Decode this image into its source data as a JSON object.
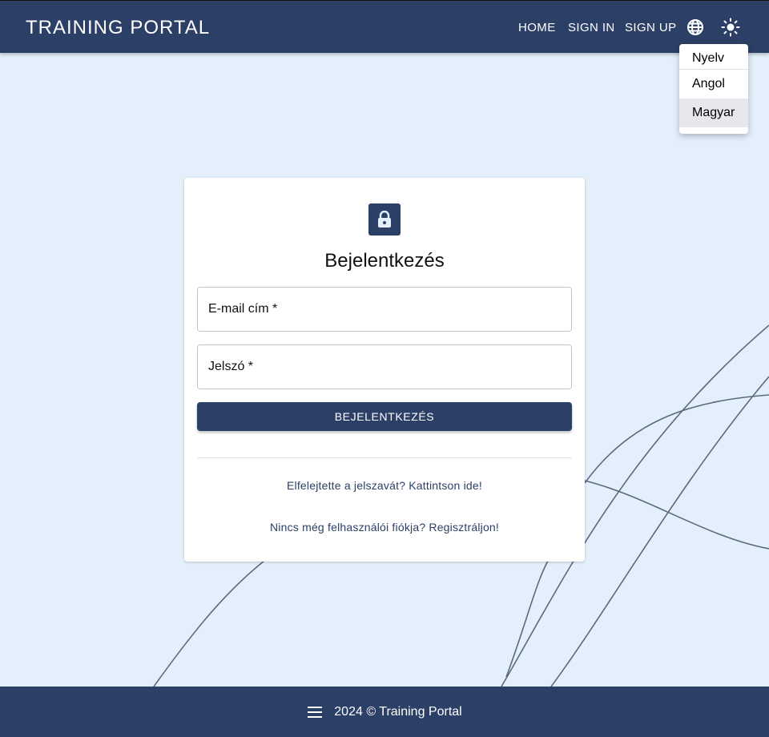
{
  "appbar": {
    "brand": "TRAINING PORTAL",
    "nav": {
      "home": "HOME",
      "sign_in": "SIGN IN",
      "sign_up": "SIGN UP"
    },
    "icons": {
      "language": "globe-icon",
      "theme": "sun-icon"
    }
  },
  "language_menu": {
    "header": "Nyelv",
    "items": [
      "Angol",
      "Magyar"
    ],
    "selected": "Magyar"
  },
  "login": {
    "title": "Bejelentkezés",
    "email_label": "E-mail cím *",
    "password_label": "Jelszó *",
    "submit_label": "BEJELENTKEZÉS",
    "forgot_link": "Elfelejtette a jelszavát? Kattintson ide!",
    "register_link": "Nincs még felhasználói fiókja? Regisztráljon!"
  },
  "footer": {
    "text": "2024 © Training Portal"
  },
  "colors": {
    "primary": "#2c3f66",
    "background": "#e3f0fc",
    "surface": "#ffffff",
    "decor_lines": "#5a6a7a"
  }
}
